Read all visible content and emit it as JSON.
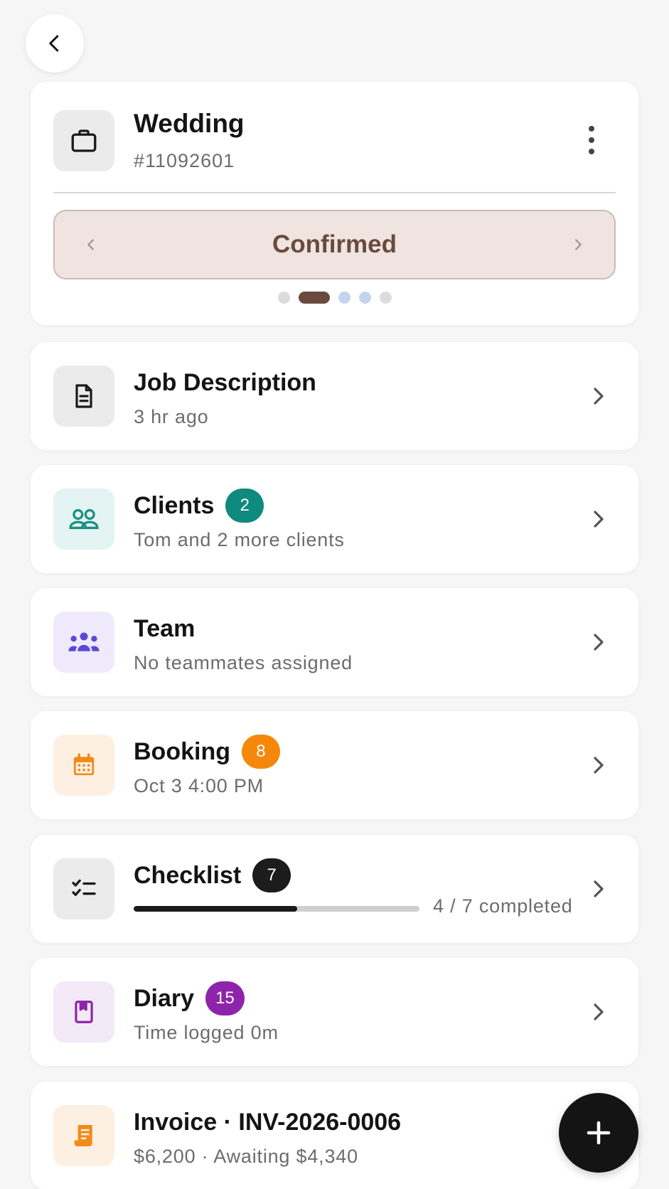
{
  "job": {
    "title": "Wedding",
    "number": "#11092601",
    "status": "Confirmed",
    "status_steps": 5,
    "status_active_index": 1,
    "status_dot_colors": [
      "#dcdcdc",
      "#6b4a3e",
      "#c5d4ee",
      "#c5d4ee",
      "#dcdcdc"
    ]
  },
  "sections": {
    "job_description": {
      "title": "Job Description",
      "subtitle": "3 hr ago",
      "icon": "document-icon"
    },
    "clients": {
      "title": "Clients",
      "badge": "2",
      "badge_color": "#0f8a7e",
      "subtitle": "Tom and 2 more clients",
      "icon": "people-icon",
      "icon_bg": "#e4f4f2",
      "icon_color": "#1c8f82"
    },
    "team": {
      "title": "Team",
      "subtitle": "No teammates assigned",
      "icon": "team-icon",
      "icon_bg": "#eeeafc",
      "icon_color": "#5b48d6"
    },
    "booking": {
      "title": "Booking",
      "badge": "8",
      "badge_color": "#f5870a",
      "subtitle": "Oct 3 4:00 PM",
      "icon": "calendar-icon",
      "icon_bg": "#fdf0e2",
      "icon_color": "#f28a17"
    },
    "checklist": {
      "title": "Checklist",
      "badge": "7",
      "badge_color": "#1c1c1c",
      "progress_done": 4,
      "progress_total": 7,
      "progress_text": "4 / 7 completed",
      "icon": "checklist-icon"
    },
    "diary": {
      "title": "Diary",
      "badge": "15",
      "badge_color": "#8e24aa",
      "subtitle": "Time logged 0m",
      "icon": "bookmark-book-icon",
      "icon_bg": "#f3e9f7",
      "icon_color": "#8e24aa"
    },
    "invoice": {
      "title": "Invoice · INV-2026-0006",
      "subtitle": "$6,200 · Awaiting $4,340",
      "icon": "receipt-icon",
      "icon_bg": "#fdf0e2",
      "icon_color": "#f28a17"
    }
  }
}
